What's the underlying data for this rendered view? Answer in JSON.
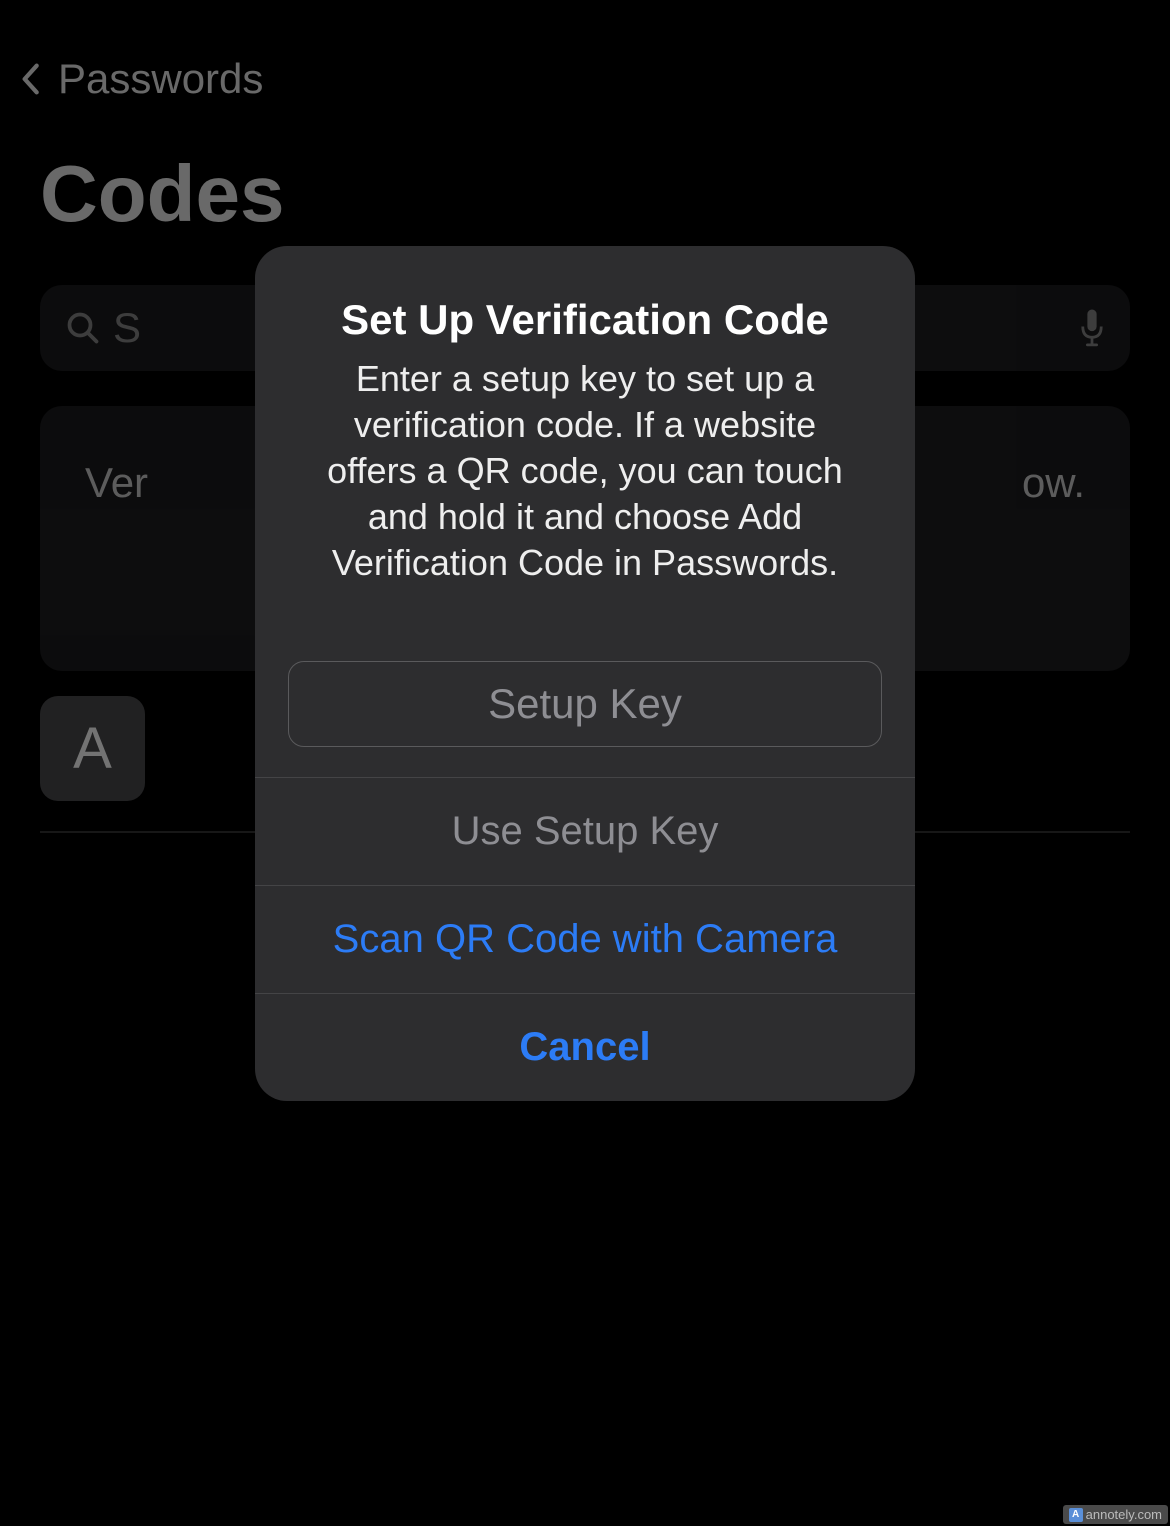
{
  "nav": {
    "back_label": "Passwords"
  },
  "page": {
    "title": "Codes"
  },
  "search": {
    "placeholder_fragment": "S"
  },
  "info_card": {
    "text_prefix": "Ver",
    "text_suffix": "ow."
  },
  "section": {
    "letter": "A"
  },
  "modal": {
    "title": "Set Up Verification Code",
    "description": "Enter a setup key to set up a verification code. If a website offers a QR code, you can touch and hold it and choose Add Verification Code in Passwords.",
    "input_placeholder": "Setup Key",
    "button_use_setup": "Use Setup Key",
    "button_scan_qr": "Scan QR Code with Camera",
    "button_cancel": "Cancel"
  },
  "watermark": {
    "text": "annotely.com"
  },
  "colors": {
    "accent_blue": "#2c7cf6",
    "disabled_gray": "#8e8e93",
    "modal_bg": "#2d2d2f"
  }
}
